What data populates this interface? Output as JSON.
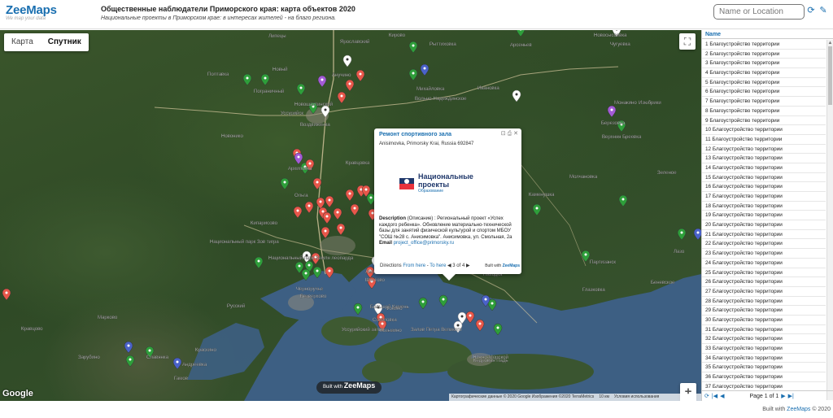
{
  "app": {
    "logo": "ZeeMaps",
    "tagline": "We map your data",
    "title": "Общественные наблюдатели Приморского края: карта объектов 2020",
    "subtitle": "Национальные проекты в Приморском крае: в интересах жителей - на благо региона."
  },
  "search": {
    "placeholder": "Name or Location"
  },
  "map": {
    "type_map": "Карта",
    "type_satellite": "Спутник",
    "selected_type": "Спутник",
    "google": "Google",
    "built_with_prefix": "Built with",
    "built_with_brand": "ZeeMaps",
    "footer": [
      "Картографические данные © 2020 Google Изображения ©2020 TerraMetrics",
      "10 км",
      "Условия использования"
    ],
    "zoom_in": "+",
    "zoom_out": "−",
    "place_labels": [
      "Липецы",
      "Ярославский",
      "Кирово",
      "Рыттиховка",
      "Арсеньев",
      "Новосысоевка",
      "Чугуевка",
      "Полтавка",
      "Пограничный",
      "Новый",
      "Вольно-Надеждинское",
      "Михайловка",
      "Ивановка",
      "Анучино",
      "Новошахтинский",
      "Воздвиженка",
      "Уссурийск",
      "Новонико",
      "Монакино",
      "Изюбрики",
      "Березовка",
      "Верхняя Бреевка",
      "Архиповка",
      "Ольга",
      "Кипарисово",
      "Кравцовка",
      "Каменушка",
      "Молчановка",
      "Зеленое",
      "Национальный парк Зов тигра",
      "Национальный парк Земля леопарда",
      "Лесное",
      "Шкотово",
      "Большой Камень",
      "Фокино",
      "Находка",
      "Партизанск",
      "Беневское",
      "Глазковка",
      "Лазо",
      "Черноручье",
      "Русский",
      "Безверхово",
      "Уссурийский залив",
      "Залив Петра Великого",
      "Южно-Морской",
      "Козьмино",
      "Гамов",
      "Андреевка",
      "Славянка",
      "Кравцово",
      "Зарубино",
      "Краскино",
      "Марково",
      "Кедровая Падь",
      "Соколовка",
      "Находка",
      "Дунай"
    ],
    "popup": {
      "title": "Ремонт спортивного зала",
      "address": "Anisimovka, Primorsky Krai, Russia 692847",
      "logo_main_1": "Национальные",
      "logo_main_2": "проекты",
      "logo_sub": "Образование",
      "description_label": "Description",
      "description_prefix": "(Описание) :",
      "description_text": "Региональный проект «Успех каждого ребенка». Обновление материально-технической базы для занятий физической культурой и спортом МБОУ \"СОШ №28 с. Анисимовка\". Анисимовка, ул. Смольная, 2а",
      "email_label": "Email",
      "email": "project_office@primorsky.ru",
      "directions_label": "Directions",
      "from_here": "From here",
      "to_here": "To here",
      "counter": "3 of 4",
      "built_with": "Built with",
      "built_brand": "ZeeMaps"
    }
  },
  "sidebar": {
    "column_header": "Name",
    "rows": [
      "1 Благоустройство территории",
      "2 Благоустройство территории",
      "3 Благоустройство территории",
      "4 Благоустройство территории",
      "5 Благоустройство территории",
      "6 Благоустройство территории",
      "7 Благоустройство территории",
      "8 Благоустройство территории",
      "9 Благоустройство территории",
      "10 Благоустройство территории",
      "11 Благоустройство территории",
      "12 Благоустройство территории",
      "13 Благоустройство территории",
      "14 Благоустройство территории",
      "15 Благоустройство территории",
      "16 Благоустройство территории",
      "17 Благоустройство территории",
      "18 Благоустройство территории",
      "19 Благоустройство территории",
      "20 Благоустройство территории",
      "21 Благоустройство территории",
      "22 Благоустройство территории",
      "23 Благоустройство территории",
      "24 Благоустройство территории",
      "25 Благоустройство территории",
      "26 Благоустройство территории",
      "27 Благоустройство территории",
      "28 Благоустройство территории",
      "29 Благоустройство территории",
      "30 Благоустройство территории",
      "31 Благоустройство территории",
      "32 Благоустройство территории",
      "33 Благоустройство территории",
      "34 Благоустройство территории",
      "35 Благоустройство территории",
      "36 Благоустройство территории",
      "37 Благоустройство территории"
    ],
    "page_label": "Page 1 of 1"
  },
  "footer": {
    "built_prefix": "Built with",
    "brand": "ZeeMaps",
    "copyright": "© 2020"
  },
  "colors": {
    "brand": "#1a6fb0",
    "marker_red": "#e8574a",
    "marker_green": "#2e9e3a",
    "marker_purple": "#a35bd6",
    "marker_blue": "#4a62c9",
    "marker_white": "#ffffff",
    "water": "#3d5f83"
  }
}
